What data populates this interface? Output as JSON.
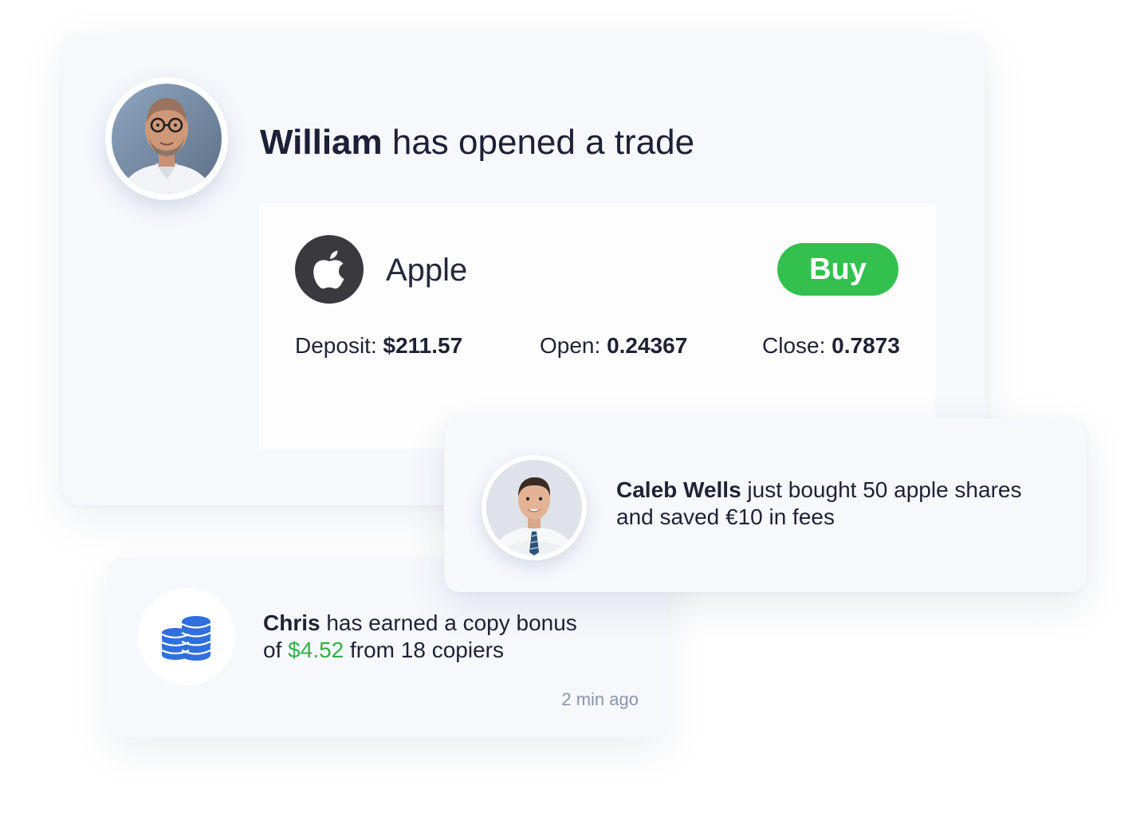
{
  "trade_card": {
    "user_name": "William",
    "headline_suffix": " has opened a trade",
    "asset_name": "Apple",
    "asset_icon": "apple-icon",
    "action_label": "Buy",
    "deposit_label": "Deposit: ",
    "deposit_value": "$211.57",
    "open_label": "Open: ",
    "open_value": "0.24367",
    "close_label": "Close: ",
    "close_value": "0.7873",
    "colors": {
      "buy_green": "#34c04f",
      "apple_circle": "#3a3a3e"
    }
  },
  "purchase_card": {
    "user_name": "Caleb Wells",
    "line1_suffix": " just bought 50 apple shares",
    "line2": "and saved €10 in fees"
  },
  "bonus_card": {
    "user_name": "Chris",
    "line1_suffix": " has earned a copy bonus",
    "line2_prefix": "of ",
    "amount": "$4.52",
    "line2_suffix": " from 18 copiers",
    "timestamp": "2 min ago",
    "icon": "coins-icon",
    "colors": {
      "amount_green": "#34b04a",
      "coins_blue": "#2f6fe0"
    }
  }
}
